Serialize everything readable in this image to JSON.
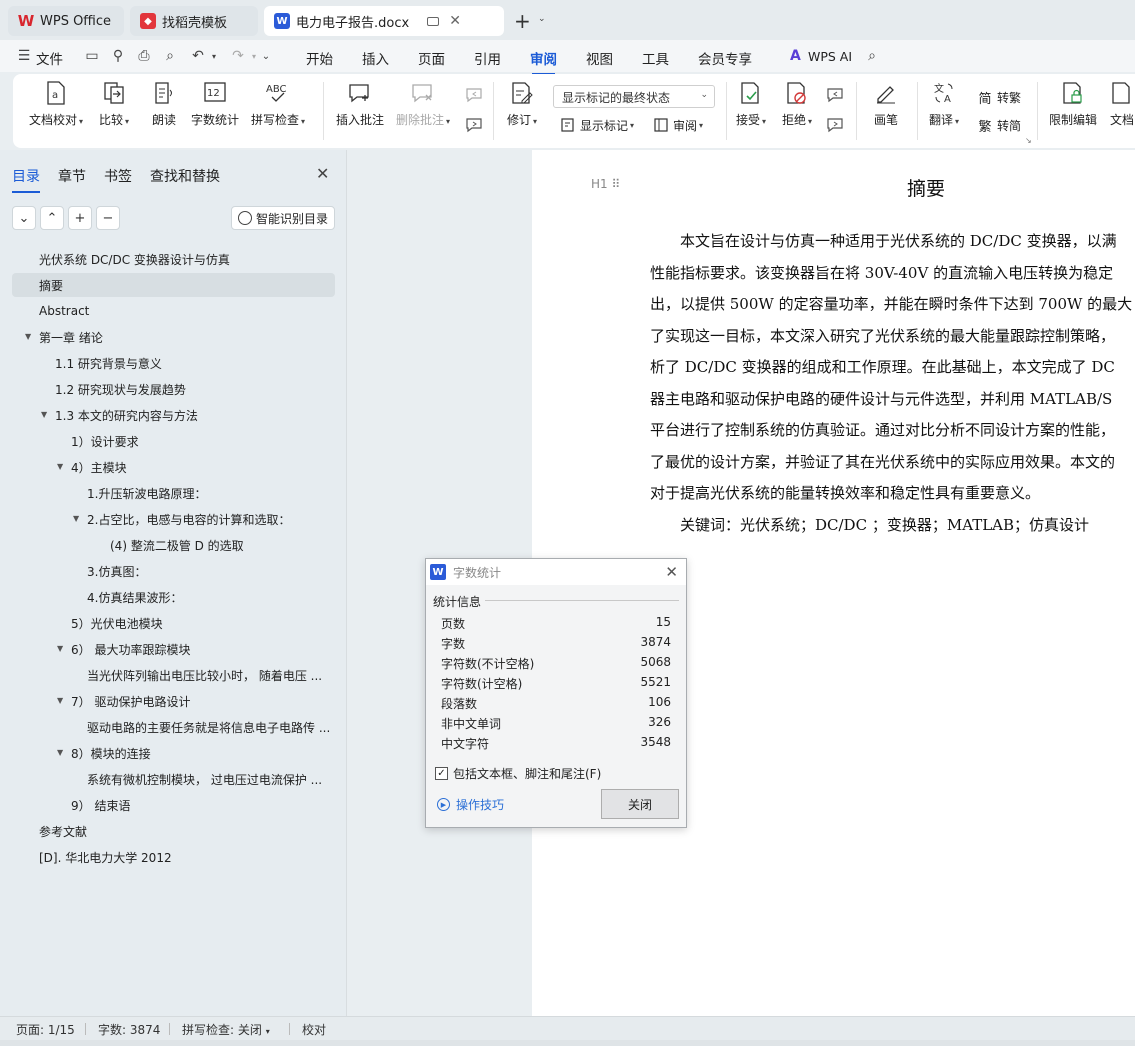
{
  "tabs": [
    {
      "label": "WPS Office",
      "active": false
    },
    {
      "label": "找稻壳模板",
      "active": false
    },
    {
      "label": "电力电子报告.docx",
      "active": true
    }
  ],
  "menu": {
    "file": "文件",
    "items": [
      "开始",
      "插入",
      "页面",
      "引用",
      "审阅",
      "视图",
      "工具",
      "会员专享"
    ],
    "active_item": "审阅",
    "wps_ai": "WPS AI"
  },
  "ribbon": {
    "doc_check": "文档校对",
    "compare": "比较",
    "read_aloud": "朗读",
    "word_count": "字数统计",
    "spell_check": "拼写检查",
    "insert_comment": "插入批注",
    "delete_comment": "删除批注",
    "revise": "修订",
    "markup_mode": "显示标记的最终状态",
    "show_markup": "显示标记",
    "review": "审阅",
    "accept": "接受",
    "reject": "拒绝",
    "pen": "画笔",
    "translate": "翻译",
    "to_traditional": "转繁",
    "to_simplified": "转简",
    "restrict_edit": "限制编辑",
    "doc_rights": "文档"
  },
  "nav": {
    "tabs": [
      "目录",
      "章节",
      "书签",
      "查找和替换"
    ],
    "active_tab": "目录",
    "smart_toc": "智能识别目录",
    "toc": [
      {
        "label": "光伏系统  DC/DC  变换器设计与仿真",
        "indent": 0,
        "arrow": false,
        "selected": false
      },
      {
        "label": "摘要",
        "indent": 0,
        "arrow": false,
        "selected": true
      },
      {
        "label": "Abstract",
        "indent": 0,
        "arrow": false,
        "selected": false
      },
      {
        "label": "第一章  绪论",
        "indent": 0,
        "arrow": true,
        "selected": false
      },
      {
        "label": "1.1  研究背景与意义",
        "indent": 1,
        "arrow": false,
        "selected": false
      },
      {
        "label": "1.2  研究现状与发展趋势",
        "indent": 1,
        "arrow": false,
        "selected": false
      },
      {
        "label": "1.3  本文的研究内容与方法",
        "indent": 1,
        "arrow": true,
        "selected": false
      },
      {
        "label": "1）设计要求",
        "indent": 2,
        "arrow": false,
        "selected": false
      },
      {
        "label": "4）主模块",
        "indent": 2,
        "arrow": true,
        "selected": false
      },
      {
        "label": "1.升压斩波电路原理：",
        "indent": 3,
        "arrow": false,
        "selected": false
      },
      {
        "label": "2.占空比，电感与电容的计算和选取：",
        "indent": 3,
        "arrow": true,
        "selected": false
      },
      {
        "label": "(4)       整流二极管  D  的选取",
        "indent": 4,
        "arrow": false,
        "selected": false
      },
      {
        "label": "3.仿真图：",
        "indent": 3,
        "arrow": false,
        "selected": false
      },
      {
        "label": "4.仿真结果波形：",
        "indent": 3,
        "arrow": false,
        "selected": false
      },
      {
        "label": "5）光伏电池模块",
        "indent": 2,
        "arrow": false,
        "selected": false
      },
      {
        "label": "6）   最大功率跟踪模块",
        "indent": 2,
        "arrow": true,
        "selected": false
      },
      {
        "label": "当光伏阵列输出电压比较小时，  随着电压 ...",
        "indent": 3,
        "arrow": false,
        "selected": false
      },
      {
        "label": "7）   驱动保护电路设计",
        "indent": 2,
        "arrow": true,
        "selected": false
      },
      {
        "label": "驱动电路的主要任务就是将信息电子电路传 ...",
        "indent": 3,
        "arrow": false,
        "selected": false
      },
      {
        "label": "8）模块的连接",
        "indent": 2,
        "arrow": true,
        "selected": false
      },
      {
        "label": "系统有微机控制模块，  过电压过电流保护 ...",
        "indent": 3,
        "arrow": false,
        "selected": false
      },
      {
        "label": "9）   结束语",
        "indent": 2,
        "arrow": false,
        "selected": false
      },
      {
        "label": "参考文献",
        "indent": 0,
        "arrow": false,
        "selected": false
      },
      {
        "label": "[D]. 华北电力大学  2012",
        "indent": 0,
        "arrow": false,
        "selected": false
      }
    ]
  },
  "document": {
    "heading": "摘要",
    "heading_marker": "H1",
    "lines": [
      "　　本文旨在设计与仿真一种适用于光伏系统的 DC/DC 变换器，以满",
      "性能指标要求。该变换器旨在将 30V-40V 的直流输入电压转换为稳定",
      "出，以提供 500W 的定容量功率，并能在瞬时条件下达到 700W 的最大",
      "了实现这一目标，本文深入研究了光伏系统的最大能量跟踪控制策略，",
      "析了 DC/DC 变换器的组成和工作原理。在此基础上，本文完成了 DC",
      "器主电路和驱动保护电路的硬件设计与元件选型，并利用 MATLAB/S",
      "平台进行了控制系统的仿真验证。通过对比分析不同设计方案的性能，",
      "了最优的设计方案，并验证了其在光伏系统中的实际应用效果。本文的",
      "对于提高光伏系统的能量转换效率和稳定性具有重要意义。",
      "　　关键词：光伏系统；DC/DC ；变换器；MATLAB；仿真设计"
    ]
  },
  "dialog": {
    "title": "字数统计",
    "group": "统计信息",
    "rows": [
      {
        "label": "页数",
        "value": "15"
      },
      {
        "label": "字数",
        "value": "3874"
      },
      {
        "label": "字符数(不计空格)",
        "value": "5068"
      },
      {
        "label": "字符数(计空格)",
        "value": "5521"
      },
      {
        "label": "段落数",
        "value": "106"
      },
      {
        "label": "非中文单词",
        "value": "326"
      },
      {
        "label": "中文字符",
        "value": "3548"
      }
    ],
    "checkbox": "包括文本框、脚注和尾注(F)",
    "checked": true,
    "tips": "操作技巧",
    "close": "关闭"
  },
  "status": {
    "page": "页面: 1/15",
    "words": "字数: 3874",
    "spell": "拼写检查: 关闭",
    "proof": "校对"
  }
}
